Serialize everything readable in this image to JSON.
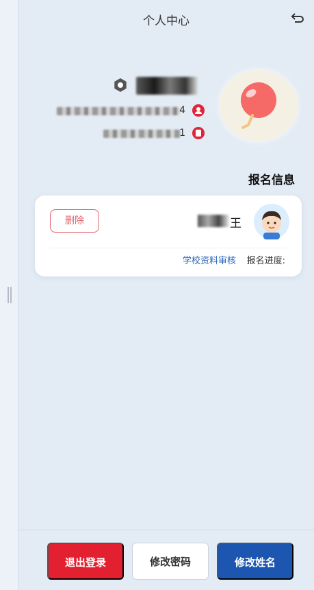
{
  "header": {
    "title": "个人中心",
    "back_icon": "back-arrow-icon"
  },
  "profile": {
    "username": "王",
    "settings_icon": "gear-icon",
    "id_prefix": "4",
    "phone_prefix": "1",
    "avatar_icon": "balloon-icon"
  },
  "section": {
    "title": "报名信息"
  },
  "registration_card": {
    "name": "王",
    "delete_label": "删除",
    "progress_label": "报名进度:",
    "progress_value": "学校资料审核"
  },
  "actions": {
    "change_name": "修改姓名",
    "change_password": "修改密码",
    "logout": "退出登录"
  },
  "colors": {
    "primary": "#1d56b0",
    "danger": "#e3202f",
    "background": "#e3ebf4"
  }
}
